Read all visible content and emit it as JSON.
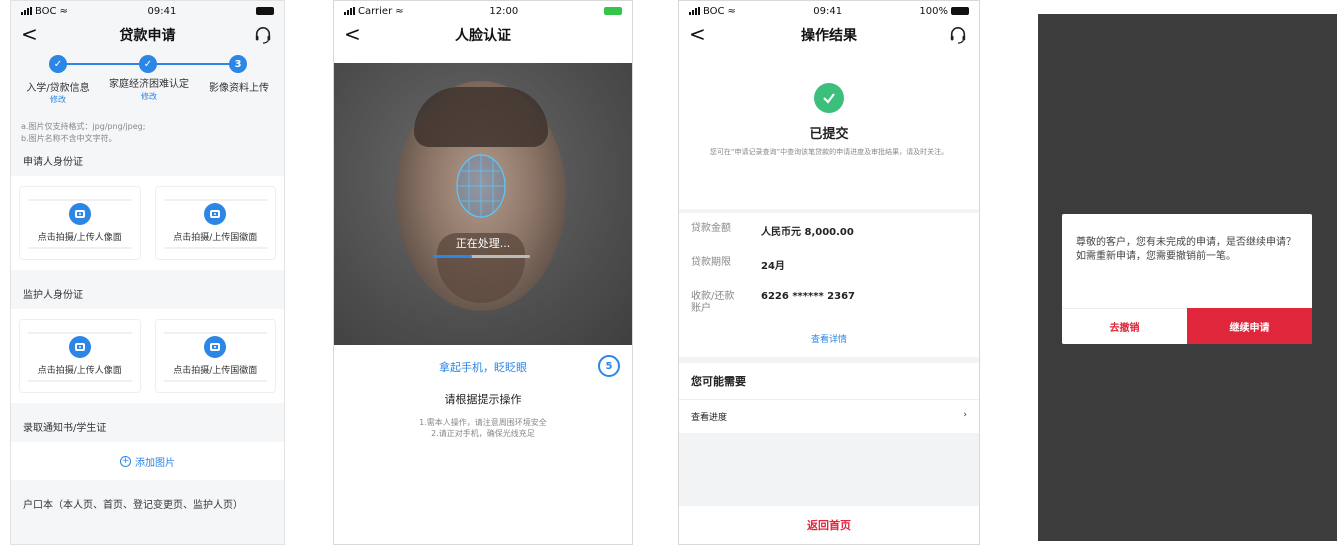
{
  "screen1": {
    "status": {
      "carrier": "BOC",
      "time": "09:41"
    },
    "title": "贷款申请",
    "back": "<",
    "steps": [
      {
        "label": "入学/贷款信息",
        "edit": "修改",
        "state": "done"
      },
      {
        "label": "家庭经济困难认定",
        "edit": "修改",
        "state": "done"
      },
      {
        "label": "影像资料上传",
        "number": "3",
        "state": "current"
      }
    ],
    "hints": [
      "a.图片仅支持格式：jpg/png/jpeg;",
      "b.图片名称不含中文字符。"
    ],
    "sections": {
      "applicant_id": "申请人身份证",
      "guardian_id": "监护人身份证",
      "notice": "录取通知书/学生证",
      "household": "户口本（本人页、首页、登记变更页、监护人页）"
    },
    "upload_portrait": "点击拍摄/上传人像面",
    "upload_emblem": "点击拍摄/上传国徽面",
    "add_image": "添加图片"
  },
  "screen2": {
    "status": {
      "carrier": "Carrier",
      "time": "12:00"
    },
    "title": "人脸认证",
    "back": "<",
    "processing": "正在处理...",
    "progress": 0.4,
    "instruction": "拿起手机，眨眨眼",
    "countdown": "5",
    "subtitle": "请根据提示操作",
    "tips": [
      "1.需本人操作，请注意周围环境安全",
      "2.请正对手机，确保光线充足"
    ]
  },
  "screen3": {
    "status": {
      "carrier": "BOC",
      "time": "09:41",
      "battery": "100%"
    },
    "title": "操作结果",
    "back": "<",
    "result_title": "已提交",
    "result_desc": "您可在“申请记录查询”中查询该笔贷款的申请进度及审批结果，请及时关注。",
    "rows": [
      {
        "key": "贷款金额",
        "value": "人民币元 8,000.00"
      },
      {
        "key": "贷款期限",
        "value": "24月"
      },
      {
        "key": "收款/还款账户",
        "value": "6226 ****** 2367"
      }
    ],
    "details_link": "查看详情",
    "may_need": "您可能需要",
    "progress_link": "查看进度",
    "back_home": "返回首页"
  },
  "screen4": {
    "message": "尊敬的客户，您有未完成的申请，是否继续申请？\n如需重新申请，您需要撤销前一笔。",
    "cancel": "去撤销",
    "continue": "继续申请"
  },
  "colors": {
    "primary": "#2b86e5",
    "accent_red": "#e0263b",
    "success": "#3bbf7a"
  }
}
